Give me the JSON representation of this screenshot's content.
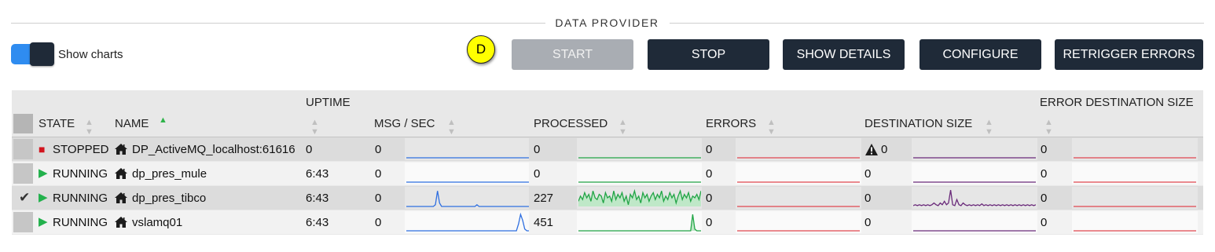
{
  "section": {
    "title": "DATA PROVIDER"
  },
  "toggle": {
    "label": "Show charts",
    "on": true
  },
  "badge": {
    "label": "D"
  },
  "buttons": {
    "start": "START",
    "stop": "STOP",
    "show_details": "SHOW DETAILS",
    "configure": "CONFIGURE",
    "retrigger_errors": "RETRIGGER ERRORS"
  },
  "table": {
    "headers": {
      "state": "STATE",
      "name": "NAME",
      "uptime": "UPTIME",
      "msg_per_sec": "MSG / SEC",
      "processed": "PROCESSED",
      "errors": "ERRORS",
      "destination_size": "DESTINATION SIZE",
      "error_destination_size": "ERROR DESTINATION SIZE"
    },
    "sorted_by": "name",
    "rows": [
      {
        "selected": false,
        "state": "STOPPED",
        "state_icon": "stop-square-icon",
        "name": "DP_ActiveMQ_localhost:61616",
        "uptime": "0",
        "msg_per_sec": "0",
        "processed": "0",
        "errors": "0",
        "destination_size": "0",
        "destination_warning": true,
        "error_destination_size": "0"
      },
      {
        "selected": false,
        "state": "RUNNING",
        "state_icon": "play-icon",
        "name": "dp_pres_mule",
        "uptime": "6:43",
        "msg_per_sec": "0",
        "processed": "0",
        "errors": "0",
        "destination_size": "0",
        "destination_warning": false,
        "error_destination_size": "0"
      },
      {
        "selected": true,
        "state": "RUNNING",
        "state_icon": "play-icon",
        "name": "dp_pres_tibco",
        "uptime": "6:43",
        "msg_per_sec": "0",
        "processed": "227",
        "errors": "0",
        "destination_size": "0",
        "destination_warning": false,
        "error_destination_size": "0"
      },
      {
        "selected": false,
        "state": "RUNNING",
        "state_icon": "play-icon",
        "name": "vslamq01",
        "uptime": "6:43",
        "msg_per_sec": "0",
        "processed": "451",
        "errors": "0",
        "destination_size": "0",
        "destination_warning": false,
        "error_destination_size": "0"
      }
    ]
  },
  "sparkline_colors": {
    "msg_per_sec": "#2f6fe0",
    "processed": "#22a546",
    "processed_fill": "#bfe8c8",
    "errors": "#e0474f",
    "destination_size": "#6a2a7a",
    "error_destination_size": "#e0474f"
  },
  "sparklines": {
    "rows": [
      {
        "msg_per_sec": [
          0,
          0,
          0,
          0,
          0,
          0,
          0,
          0,
          0,
          0,
          0,
          0,
          0,
          0,
          0,
          0,
          0,
          0,
          0,
          0,
          0,
          0,
          0,
          0,
          0,
          0,
          0,
          0,
          0,
          0,
          0,
          0,
          0,
          0,
          0,
          0,
          0,
          0,
          0,
          0,
          0,
          0,
          0,
          0,
          0,
          0,
          0,
          0,
          0,
          0,
          0,
          0,
          0,
          0,
          0,
          0,
          0,
          0,
          0,
          0
        ],
        "processed": [
          0,
          0,
          0,
          0,
          0,
          0,
          0,
          0,
          0,
          0,
          0,
          0,
          0,
          0,
          0,
          0,
          0,
          0,
          0,
          0,
          0,
          0,
          0,
          0,
          0,
          0,
          0,
          0,
          0,
          0,
          0,
          0,
          0,
          0,
          0,
          0,
          0,
          0,
          0,
          0,
          0,
          0,
          0,
          0,
          0,
          0,
          0,
          0,
          0,
          0,
          0,
          0,
          0,
          0,
          0,
          0,
          0,
          0,
          0,
          0
        ],
        "errors": [
          0,
          0,
          0,
          0,
          0,
          0,
          0,
          0,
          0,
          0,
          0,
          0,
          0,
          0,
          0,
          0,
          0,
          0,
          0,
          0,
          0,
          0,
          0,
          0,
          0,
          0,
          0,
          0,
          0,
          0,
          0,
          0,
          0,
          0,
          0,
          0,
          0,
          0,
          0,
          0,
          0,
          0,
          0,
          0,
          0,
          0,
          0,
          0,
          0,
          0,
          0,
          0,
          0,
          0,
          0,
          0,
          0,
          0,
          0,
          0
        ],
        "destination_size": [
          0,
          0,
          0,
          0,
          0,
          0,
          0,
          0,
          0,
          0,
          0,
          0,
          0,
          0,
          0,
          0,
          0,
          0,
          0,
          0,
          0,
          0,
          0,
          0,
          0,
          0,
          0,
          0,
          0,
          0,
          0,
          0,
          0,
          0,
          0,
          0,
          0,
          0,
          0,
          0,
          0,
          0,
          0,
          0,
          0,
          0,
          0,
          0,
          0,
          0,
          0,
          0,
          0,
          0,
          0,
          0,
          0,
          0,
          0,
          0
        ],
        "error_destination_size": [
          0,
          0,
          0,
          0,
          0,
          0,
          0,
          0,
          0,
          0,
          0,
          0,
          0,
          0,
          0,
          0,
          0,
          0,
          0,
          0,
          0,
          0,
          0,
          0,
          0,
          0,
          0,
          0,
          0,
          0,
          0,
          0,
          0,
          0,
          0,
          0,
          0,
          0,
          0,
          0,
          0,
          0,
          0,
          0,
          0,
          0,
          0,
          0,
          0,
          0,
          0,
          0,
          0,
          0,
          0,
          0,
          0,
          0,
          0,
          0
        ]
      },
      {
        "msg_per_sec": [
          0,
          0,
          0,
          0,
          0,
          0,
          0,
          0,
          0,
          0,
          0,
          0,
          0,
          0,
          0,
          0,
          0,
          0,
          0,
          0,
          0,
          0,
          0,
          0,
          0,
          0,
          0,
          0,
          0,
          0,
          0,
          0,
          0,
          0,
          0,
          0,
          0,
          0,
          0,
          0,
          0,
          0,
          0,
          0,
          0,
          0,
          0,
          0,
          0,
          0,
          0,
          0,
          0,
          0,
          0,
          0,
          0,
          0,
          0,
          0
        ],
        "processed": [
          0,
          0,
          0,
          0,
          0,
          0,
          0,
          0,
          0,
          0,
          0,
          0,
          0,
          0,
          0,
          0,
          0,
          0,
          0,
          0,
          0,
          0,
          0,
          0,
          0,
          0,
          0,
          0,
          0,
          0,
          0,
          0,
          0,
          0,
          0,
          0,
          0,
          0,
          0,
          0,
          0,
          0,
          0,
          0,
          0,
          0,
          0,
          0,
          0,
          0,
          0,
          0,
          0,
          0,
          0,
          0,
          0,
          0,
          0,
          0
        ],
        "errors": [
          0,
          0,
          0,
          0,
          0,
          0,
          0,
          0,
          0,
          0,
          0,
          0,
          0,
          0,
          0,
          0,
          0,
          0,
          0,
          0,
          0,
          0,
          0,
          0,
          0,
          0,
          0,
          0,
          0,
          0,
          0,
          0,
          0,
          0,
          0,
          0,
          0,
          0,
          0,
          0,
          0,
          0,
          0,
          0,
          0,
          0,
          0,
          0,
          0,
          0,
          0,
          0,
          0,
          0,
          0,
          0,
          0,
          0,
          0,
          0
        ],
        "destination_size": [
          0,
          0,
          0,
          0,
          0,
          0,
          0,
          0,
          0,
          0,
          0,
          0,
          0,
          0,
          0,
          0,
          0,
          0,
          0,
          0,
          0,
          0,
          0,
          0,
          0,
          0,
          0,
          0,
          0,
          0,
          0,
          0,
          0,
          0,
          0,
          0,
          0,
          0,
          0,
          0,
          0,
          0,
          0,
          0,
          0,
          0,
          0,
          0,
          0,
          0,
          0,
          0,
          0,
          0,
          0,
          0,
          0,
          0,
          0,
          0
        ],
        "error_destination_size": [
          0,
          0,
          0,
          0,
          0,
          0,
          0,
          0,
          0,
          0,
          0,
          0,
          0,
          0,
          0,
          0,
          0,
          0,
          0,
          0,
          0,
          0,
          0,
          0,
          0,
          0,
          0,
          0,
          0,
          0,
          0,
          0,
          0,
          0,
          0,
          0,
          0,
          0,
          0,
          0,
          0,
          0,
          0,
          0,
          0,
          0,
          0,
          0,
          0,
          0,
          0,
          0,
          0,
          0,
          0,
          0,
          0,
          0,
          0,
          0
        ]
      },
      {
        "msg_per_sec": [
          0,
          0,
          0,
          0,
          0,
          0,
          0,
          0,
          0,
          0,
          0,
          0,
          0,
          0,
          0.1,
          0.9,
          0.2,
          0,
          0,
          0,
          0,
          0,
          0,
          0,
          0,
          0,
          0,
          0,
          0,
          0,
          0,
          0,
          0,
          0,
          0.1,
          0,
          0,
          0,
          0,
          0,
          0,
          0,
          0,
          0,
          0,
          0,
          0,
          0,
          0,
          0,
          0,
          0,
          0,
          0,
          0,
          0,
          0,
          0,
          0,
          0
        ],
        "processed": [
          0.3,
          0.6,
          0.4,
          0.8,
          0.5,
          0.7,
          0.3,
          0.9,
          0.5,
          0.4,
          0.7,
          0.6,
          0.2,
          0.8,
          0.5,
          0.6,
          0.3,
          0.9,
          0.4,
          0.7,
          0.5,
          0.8,
          0.3,
          0.6,
          0.1,
          0.7,
          0.5,
          0.9,
          0.4,
          0.6,
          0.2,
          0.8,
          0.5,
          0.7,
          0.3,
          0.6,
          0.8,
          0.4,
          0.7,
          0.5,
          0.9,
          0.3,
          0.6,
          0.4,
          0.8,
          0.5,
          0.7,
          0.2,
          0.6,
          0.9,
          0.4,
          0.7,
          0.5,
          0.8,
          0.3,
          0.6,
          0.5,
          0.7,
          0.4,
          0.9
        ],
        "errors": [
          0,
          0,
          0,
          0,
          0,
          0,
          0,
          0,
          0,
          0,
          0,
          0,
          0,
          0,
          0,
          0,
          0,
          0,
          0,
          0,
          0,
          0,
          0,
          0,
          0,
          0,
          0,
          0,
          0,
          0,
          0,
          0,
          0,
          0,
          0,
          0,
          0,
          0,
          0,
          0,
          0,
          0,
          0,
          0,
          0,
          0,
          0,
          0,
          0,
          0,
          0,
          0,
          0,
          0,
          0,
          0,
          0,
          0,
          0,
          0
        ],
        "destination_size": [
          0.05,
          0.1,
          0.05,
          0.1,
          0.05,
          0.1,
          0.05,
          0.1,
          0.05,
          0.1,
          0.2,
          0.1,
          0.05,
          0.2,
          0.1,
          0.3,
          0.1,
          0.2,
          0.95,
          0.1,
          0.05,
          0.4,
          0.1,
          0.05,
          0.2,
          0.1,
          0.05,
          0.1,
          0.05,
          0.1,
          0.05,
          0.1,
          0.05,
          0.15,
          0.05,
          0.1,
          0.05,
          0.1,
          0.05,
          0.1,
          0.05,
          0.1,
          0.05,
          0.1,
          0.05,
          0.1,
          0.05,
          0.1,
          0.05,
          0.1,
          0.05,
          0.1,
          0.05,
          0.1,
          0.05,
          0.1,
          0.05,
          0.1,
          0.05,
          0.1
        ],
        "error_destination_size": [
          0,
          0,
          0,
          0,
          0,
          0,
          0,
          0,
          0,
          0,
          0,
          0,
          0,
          0,
          0,
          0,
          0,
          0,
          0,
          0,
          0,
          0,
          0,
          0,
          0,
          0,
          0,
          0,
          0,
          0,
          0,
          0,
          0,
          0,
          0,
          0,
          0,
          0,
          0,
          0,
          0,
          0,
          0,
          0,
          0,
          0,
          0,
          0,
          0,
          0,
          0,
          0,
          0,
          0,
          0,
          0,
          0,
          0,
          0,
          0
        ]
      },
      {
        "msg_per_sec": [
          0,
          0,
          0,
          0,
          0,
          0,
          0,
          0,
          0,
          0,
          0,
          0,
          0,
          0,
          0,
          0,
          0,
          0,
          0,
          0,
          0,
          0,
          0,
          0,
          0,
          0,
          0,
          0,
          0,
          0,
          0,
          0,
          0,
          0,
          0,
          0,
          0,
          0,
          0,
          0,
          0,
          0,
          0,
          0,
          0,
          0,
          0,
          0,
          0,
          0,
          0,
          0,
          0,
          0,
          0.4,
          0.95,
          0.6,
          0.1,
          0,
          0
        ],
        "processed": [
          0,
          0,
          0,
          0,
          0,
          0,
          0,
          0,
          0,
          0,
          0,
          0,
          0,
          0,
          0,
          0,
          0,
          0,
          0,
          0,
          0,
          0,
          0,
          0,
          0,
          0,
          0,
          0,
          0,
          0,
          0,
          0,
          0,
          0,
          0,
          0,
          0,
          0,
          0,
          0,
          0,
          0,
          0,
          0,
          0,
          0,
          0,
          0,
          0,
          0,
          0,
          0,
          0,
          0,
          0,
          0.95,
          0.1,
          0,
          0,
          0
        ],
        "errors": [
          0,
          0,
          0,
          0,
          0,
          0,
          0,
          0,
          0,
          0,
          0,
          0,
          0,
          0,
          0,
          0,
          0,
          0,
          0,
          0,
          0,
          0,
          0,
          0,
          0,
          0,
          0,
          0,
          0,
          0,
          0,
          0,
          0,
          0,
          0,
          0,
          0,
          0,
          0,
          0,
          0,
          0,
          0,
          0,
          0,
          0,
          0,
          0,
          0,
          0,
          0,
          0,
          0,
          0,
          0,
          0,
          0,
          0,
          0,
          0
        ],
        "destination_size": [
          0,
          0,
          0,
          0,
          0,
          0,
          0,
          0,
          0,
          0,
          0,
          0,
          0,
          0,
          0,
          0,
          0,
          0,
          0,
          0,
          0,
          0,
          0,
          0,
          0,
          0,
          0,
          0,
          0,
          0,
          0,
          0,
          0,
          0,
          0,
          0,
          0,
          0,
          0,
          0,
          0,
          0,
          0,
          0,
          0,
          0,
          0,
          0,
          0,
          0,
          0,
          0,
          0,
          0,
          0,
          0,
          0,
          0,
          0,
          0
        ],
        "error_destination_size": [
          0,
          0,
          0,
          0,
          0,
          0,
          0,
          0,
          0,
          0,
          0,
          0,
          0,
          0,
          0,
          0,
          0,
          0,
          0,
          0,
          0,
          0,
          0,
          0,
          0,
          0,
          0,
          0,
          0,
          0,
          0,
          0,
          0,
          0,
          0,
          0,
          0,
          0,
          0,
          0,
          0,
          0,
          0,
          0,
          0,
          0,
          0,
          0,
          0,
          0,
          0,
          0,
          0,
          0,
          0,
          0,
          0,
          0,
          0,
          0
        ]
      }
    ]
  }
}
